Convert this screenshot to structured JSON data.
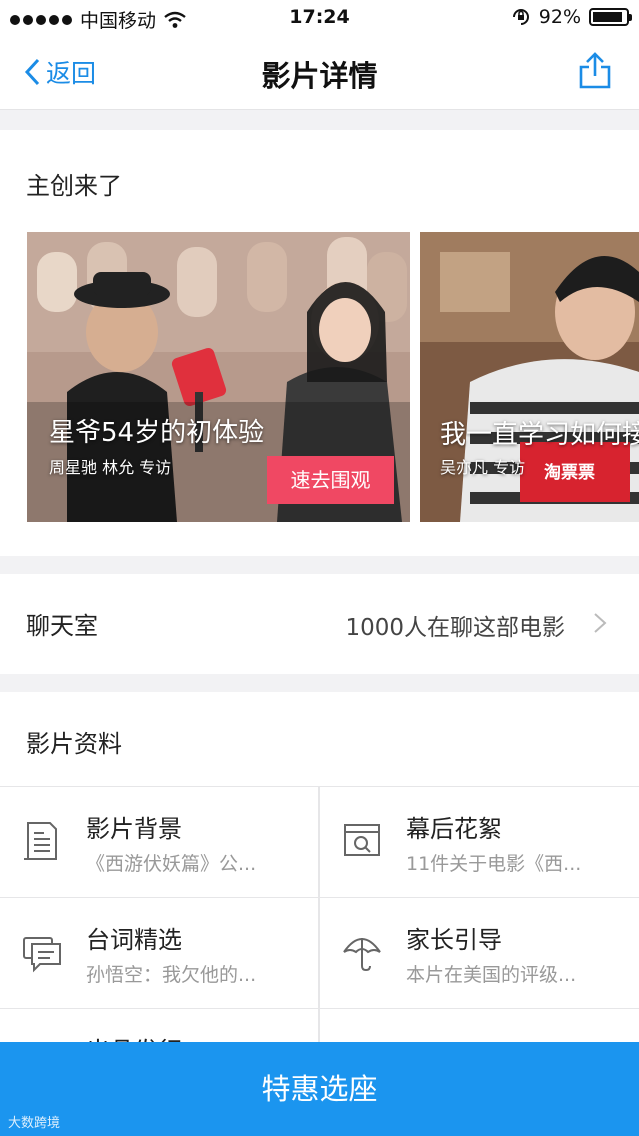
{
  "status_bar": {
    "carrier": "中国移动",
    "time": "17:24",
    "battery_percent": "92%",
    "battery_level": 0.92
  },
  "nav": {
    "back_label": "返回",
    "title": "影片详情"
  },
  "creators": {
    "section_title": "主创来了",
    "cards": [
      {
        "title": "星爷54岁的初体验",
        "subtitle": "周星驰 林允 专访",
        "action_label": "速去围观"
      },
      {
        "title": "我一直学习如何接",
        "subtitle": "吴亦凡 专访",
        "mic_logo_text": "淘票票"
      }
    ]
  },
  "chat": {
    "label": "聊天室",
    "count_text": "1000人在聊这部电影"
  },
  "film_info": {
    "section_title": "影片资料",
    "items": [
      {
        "title": "影片背景",
        "subtitle": "《西游伏妖篇》公...",
        "icon": "document-icon"
      },
      {
        "title": "幕后花絮",
        "subtitle": "11件关于电影《西...",
        "icon": "browser-search-icon"
      },
      {
        "title": "台词精选",
        "subtitle": "孙悟空：我欠他的...",
        "icon": "chat-bubbles-icon"
      },
      {
        "title": "家长引导",
        "subtitle": "本片在美国的评级...",
        "icon": "umbrella-icon"
      },
      {
        "title": "出品发行",
        "subtitle": "",
        "icon": ""
      }
    ]
  },
  "bottom_action": {
    "label": "特惠选座"
  },
  "watermark": "大数跨境",
  "colors": {
    "accent_blue": "#1b8ce6",
    "cta_blue": "#1b95ef",
    "watch_button_pink": "#f04863",
    "page_background": "#f2f2f4"
  }
}
